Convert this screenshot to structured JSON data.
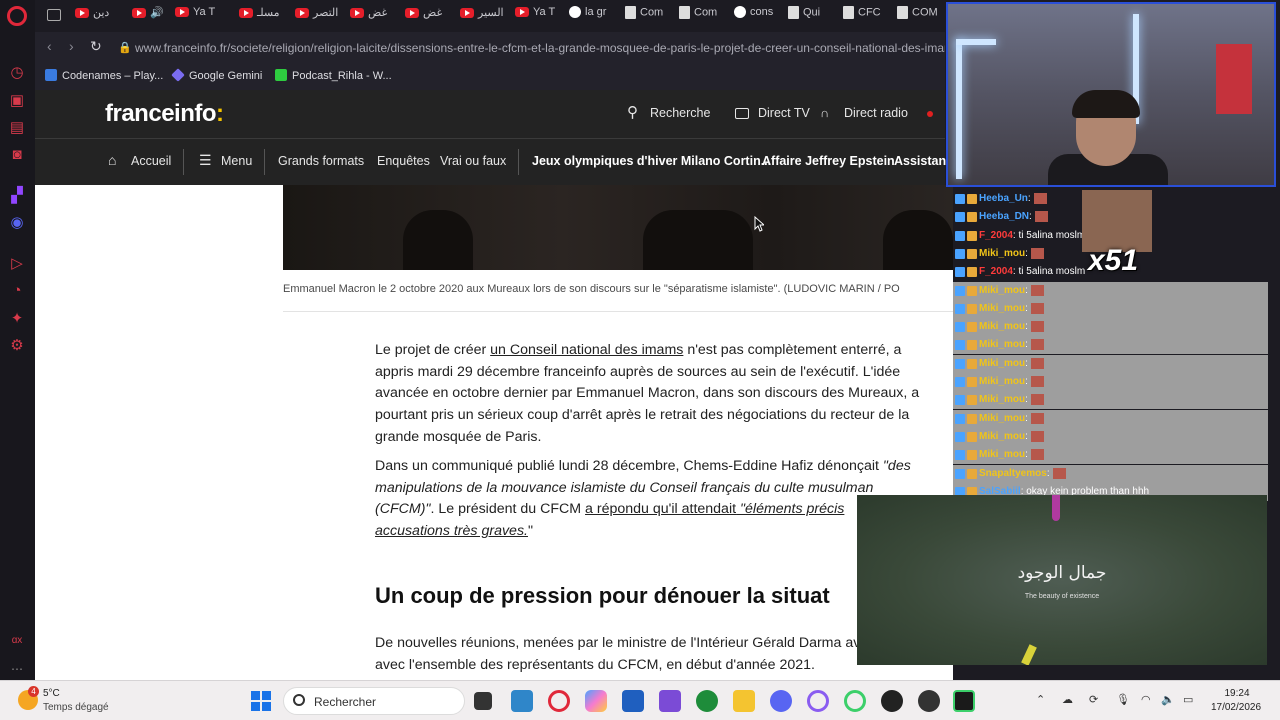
{
  "browser": {
    "tabs": [
      {
        "label": "دين",
        "icon": "youtube-icon"
      },
      {
        "label": "",
        "icon": "youtube-icon"
      },
      {
        "label": "Ya T",
        "icon": "youtube-icon"
      },
      {
        "label": "مسلـ",
        "icon": "youtube-icon"
      },
      {
        "label": "التصر",
        "icon": "youtube-icon"
      },
      {
        "label": "غض",
        "icon": "youtube-icon"
      },
      {
        "label": "غض",
        "icon": "youtube-icon"
      },
      {
        "label": "السير",
        "icon": "youtube-icon"
      },
      {
        "label": "Ya T",
        "icon": "youtube-icon"
      },
      {
        "label": "la gr",
        "icon": "google-icon"
      },
      {
        "label": "Com",
        "icon": "doc-icon"
      },
      {
        "label": "Com",
        "icon": "doc-icon"
      },
      {
        "label": "cons",
        "icon": "google-icon"
      },
      {
        "label": "Qui",
        "icon": "doc-icon"
      },
      {
        "label": "CFC",
        "icon": "doc-icon"
      },
      {
        "label": "COM",
        "icon": "doc-icon"
      }
    ],
    "url": "www.franceinfo.fr/societe/religion/religion-laicite/dissensions-entre-le-cfcm-et-la-grande-mosquee-de-paris-le-projet-de-creer-un-conseil-national-des-imams",
    "bookmarks": [
      {
        "label": "Codenames – Play...",
        "color": "#3a7be0"
      },
      {
        "label": "Google Gemini",
        "color": "#7a6cf0"
      },
      {
        "label": "Podcast_Rihla - W...",
        "color": "#2ecc40"
      }
    ]
  },
  "site": {
    "logo": "franceinfo",
    "logo_colon": ":",
    "top_links": {
      "search": "Recherche",
      "direct_tv": "Direct TV",
      "direct_radio": "Direct radio"
    },
    "nav": {
      "home": "Accueil",
      "menu": "Menu",
      "items": [
        "Grands formats",
        "Enquêtes",
        "Vrai ou faux"
      ],
      "topics": [
        "Jeux olympiques d'hiver Milano Cortin...",
        "Affaire Jeffrey Epstein",
        "Assistant"
      ]
    }
  },
  "article": {
    "caption": "Emmanuel Macron le 2 octobre 2020 aux Mureaux lors de son discours sur le \"séparatisme islamiste\". (LUDOVIC MARIN / PO",
    "p1_pre": "Le projet de créer ",
    "p1_link": "un Conseil national des imams",
    "p1_post": " n'est pas complètement enterré, a appris mardi 29 décembre franceinfo auprès de sources au sein de l'exécutif. L'idée avancée en octobre dernier par Emmanuel Macron, dans son discours des Mureaux, a pourtant pris un sérieux coup d'arrêt après le retrait des négociations du recteur de la grande mosquée de Paris.",
    "p2_pre": "Dans un communiqué publié lundi 28 décembre, Chems-Eddine Hafiz dénonçait ",
    "p2_quote": "\"des manipulations de la mouvance islamiste du Conseil français du culte musulman (CFCM)\"",
    "p2_mid": ". Le président du CFCM ",
    "p2_link": "a répondu qu'il attendait",
    "p2_quote2": " \"éléments précis",
    "p2_quote3": "accusations très graves.",
    "p2_end": "\"",
    "subhead": "Un coup de pression pour dénouer la situat",
    "p3": "De nouvelles réunions, menées par le ministre de l'Intérieur Gérald Darma avoir lieu avec l'ensemble des représentants du CFCM, en début d'année 2021."
  },
  "chat": {
    "rows": [
      {
        "user": "Heeba_Un",
        "color": "#4aa3ff",
        "msg": ":",
        "grey": false
      },
      {
        "user": "Heeba_DN",
        "color": "#4aa3ff",
        "msg": ":",
        "grey": false
      },
      {
        "user": "F_2004",
        "color": "#ff3b3b",
        "msg": ": ti 5alina moslm",
        "grey": false
      },
      {
        "user": "Miki_mou",
        "color": "#f0c419",
        "msg": ":",
        "grey": false
      },
      {
        "user": "F_2004",
        "color": "#ff3b3b",
        "msg": ": ti 5alina moslm",
        "grey": false
      },
      {
        "user": "Miki_mou",
        "color": "#f0c419",
        "msg": ":",
        "grey": true
      },
      {
        "user": "Miki_mou",
        "color": "#f0c419",
        "msg": ":",
        "grey": true
      },
      {
        "user": "Miki_mou",
        "color": "#f0c419",
        "msg": ":",
        "grey": true
      },
      {
        "user": "Miki_mou",
        "color": "#f0c419",
        "msg": ":",
        "grey": true
      },
      {
        "user": "Miki_mou",
        "color": "#f0c419",
        "msg": ":",
        "grey": true
      },
      {
        "user": "Miki_mou",
        "color": "#f0c419",
        "msg": ":",
        "grey": true
      },
      {
        "user": "Miki_mou",
        "color": "#f0c419",
        "msg": ":",
        "grey": true
      },
      {
        "user": "Miki_mou",
        "color": "#f0c419",
        "msg": ":",
        "grey": true
      },
      {
        "user": "Miki_mou",
        "color": "#f0c419",
        "msg": ":",
        "grey": true
      },
      {
        "user": "Miki_mou",
        "color": "#f0c419",
        "msg": ":",
        "grey": true
      },
      {
        "user": "Snapaltyemos",
        "color": "#f0c419",
        "msg": ":",
        "grey": true
      },
      {
        "user": "SalSabiil",
        "color": "#4aa3ff",
        "msg": ": okay kein problem than hhh",
        "grey": true
      }
    ],
    "emote_count": "x51"
  },
  "video": {
    "title": "جمال الوجود",
    "subtitle": "The beauty of existence"
  },
  "taskbar": {
    "weather_badge": "4",
    "temp": "5°C",
    "weather": "Temps dégagé",
    "search": "Rechercher",
    "time": "19:24",
    "date": "17/02/2026"
  }
}
